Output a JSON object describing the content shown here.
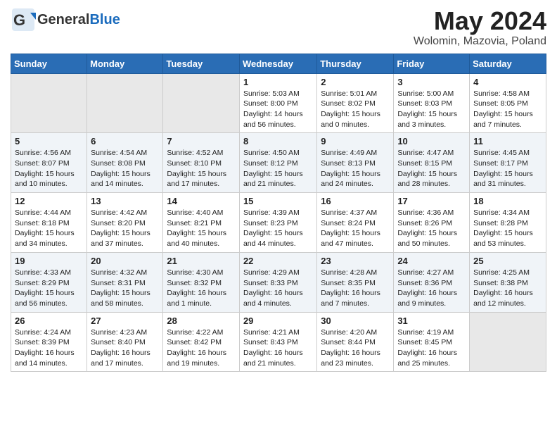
{
  "header": {
    "logo_general": "General",
    "logo_blue": "Blue",
    "title": "May 2024",
    "subtitle": "Wolomin, Mazovia, Poland"
  },
  "weekdays": [
    "Sunday",
    "Monday",
    "Tuesday",
    "Wednesday",
    "Thursday",
    "Friday",
    "Saturday"
  ],
  "weeks": [
    [
      {
        "day": "",
        "info": ""
      },
      {
        "day": "",
        "info": ""
      },
      {
        "day": "",
        "info": ""
      },
      {
        "day": "1",
        "info": "Sunrise: 5:03 AM\nSunset: 8:00 PM\nDaylight: 14 hours\nand 56 minutes."
      },
      {
        "day": "2",
        "info": "Sunrise: 5:01 AM\nSunset: 8:02 PM\nDaylight: 15 hours\nand 0 minutes."
      },
      {
        "day": "3",
        "info": "Sunrise: 5:00 AM\nSunset: 8:03 PM\nDaylight: 15 hours\nand 3 minutes."
      },
      {
        "day": "4",
        "info": "Sunrise: 4:58 AM\nSunset: 8:05 PM\nDaylight: 15 hours\nand 7 minutes."
      }
    ],
    [
      {
        "day": "5",
        "info": "Sunrise: 4:56 AM\nSunset: 8:07 PM\nDaylight: 15 hours\nand 10 minutes."
      },
      {
        "day": "6",
        "info": "Sunrise: 4:54 AM\nSunset: 8:08 PM\nDaylight: 15 hours\nand 14 minutes."
      },
      {
        "day": "7",
        "info": "Sunrise: 4:52 AM\nSunset: 8:10 PM\nDaylight: 15 hours\nand 17 minutes."
      },
      {
        "day": "8",
        "info": "Sunrise: 4:50 AM\nSunset: 8:12 PM\nDaylight: 15 hours\nand 21 minutes."
      },
      {
        "day": "9",
        "info": "Sunrise: 4:49 AM\nSunset: 8:13 PM\nDaylight: 15 hours\nand 24 minutes."
      },
      {
        "day": "10",
        "info": "Sunrise: 4:47 AM\nSunset: 8:15 PM\nDaylight: 15 hours\nand 28 minutes."
      },
      {
        "day": "11",
        "info": "Sunrise: 4:45 AM\nSunset: 8:17 PM\nDaylight: 15 hours\nand 31 minutes."
      }
    ],
    [
      {
        "day": "12",
        "info": "Sunrise: 4:44 AM\nSunset: 8:18 PM\nDaylight: 15 hours\nand 34 minutes."
      },
      {
        "day": "13",
        "info": "Sunrise: 4:42 AM\nSunset: 8:20 PM\nDaylight: 15 hours\nand 37 minutes."
      },
      {
        "day": "14",
        "info": "Sunrise: 4:40 AM\nSunset: 8:21 PM\nDaylight: 15 hours\nand 40 minutes."
      },
      {
        "day": "15",
        "info": "Sunrise: 4:39 AM\nSunset: 8:23 PM\nDaylight: 15 hours\nand 44 minutes."
      },
      {
        "day": "16",
        "info": "Sunrise: 4:37 AM\nSunset: 8:24 PM\nDaylight: 15 hours\nand 47 minutes."
      },
      {
        "day": "17",
        "info": "Sunrise: 4:36 AM\nSunset: 8:26 PM\nDaylight: 15 hours\nand 50 minutes."
      },
      {
        "day": "18",
        "info": "Sunrise: 4:34 AM\nSunset: 8:28 PM\nDaylight: 15 hours\nand 53 minutes."
      }
    ],
    [
      {
        "day": "19",
        "info": "Sunrise: 4:33 AM\nSunset: 8:29 PM\nDaylight: 15 hours\nand 56 minutes."
      },
      {
        "day": "20",
        "info": "Sunrise: 4:32 AM\nSunset: 8:31 PM\nDaylight: 15 hours\nand 58 minutes."
      },
      {
        "day": "21",
        "info": "Sunrise: 4:30 AM\nSunset: 8:32 PM\nDaylight: 16 hours\nand 1 minute."
      },
      {
        "day": "22",
        "info": "Sunrise: 4:29 AM\nSunset: 8:33 PM\nDaylight: 16 hours\nand 4 minutes."
      },
      {
        "day": "23",
        "info": "Sunrise: 4:28 AM\nSunset: 8:35 PM\nDaylight: 16 hours\nand 7 minutes."
      },
      {
        "day": "24",
        "info": "Sunrise: 4:27 AM\nSunset: 8:36 PM\nDaylight: 16 hours\nand 9 minutes."
      },
      {
        "day": "25",
        "info": "Sunrise: 4:25 AM\nSunset: 8:38 PM\nDaylight: 16 hours\nand 12 minutes."
      }
    ],
    [
      {
        "day": "26",
        "info": "Sunrise: 4:24 AM\nSunset: 8:39 PM\nDaylight: 16 hours\nand 14 minutes."
      },
      {
        "day": "27",
        "info": "Sunrise: 4:23 AM\nSunset: 8:40 PM\nDaylight: 16 hours\nand 17 minutes."
      },
      {
        "day": "28",
        "info": "Sunrise: 4:22 AM\nSunset: 8:42 PM\nDaylight: 16 hours\nand 19 minutes."
      },
      {
        "day": "29",
        "info": "Sunrise: 4:21 AM\nSunset: 8:43 PM\nDaylight: 16 hours\nand 21 minutes."
      },
      {
        "day": "30",
        "info": "Sunrise: 4:20 AM\nSunset: 8:44 PM\nDaylight: 16 hours\nand 23 minutes."
      },
      {
        "day": "31",
        "info": "Sunrise: 4:19 AM\nSunset: 8:45 PM\nDaylight: 16 hours\nand 25 minutes."
      },
      {
        "day": "",
        "info": ""
      }
    ]
  ]
}
